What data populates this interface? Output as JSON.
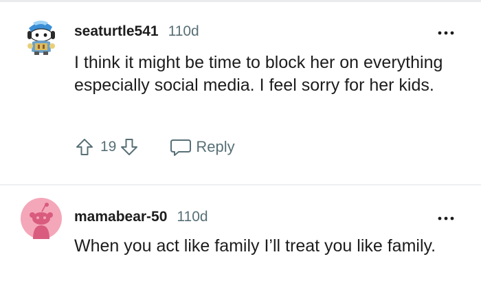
{
  "comments": [
    {
      "username": "seaturtle541",
      "age": "110d",
      "body": "I think it might be time to block her on everything especially social media. I feel sorry for her kids.",
      "score": "19",
      "reply_label": "Reply",
      "avatar_icon": "snoo-avatar-blue-icon"
    },
    {
      "username": "mamabear-50",
      "age": "110d",
      "body": "When you act like family I’ll treat you like family.",
      "avatar_icon": "snoo-avatar-pink-icon"
    }
  ],
  "colors": {
    "text": "#1c1c1c",
    "meta": "#576f76",
    "divider": "#edeff1",
    "avatar_pink": "#f4a7b9"
  }
}
